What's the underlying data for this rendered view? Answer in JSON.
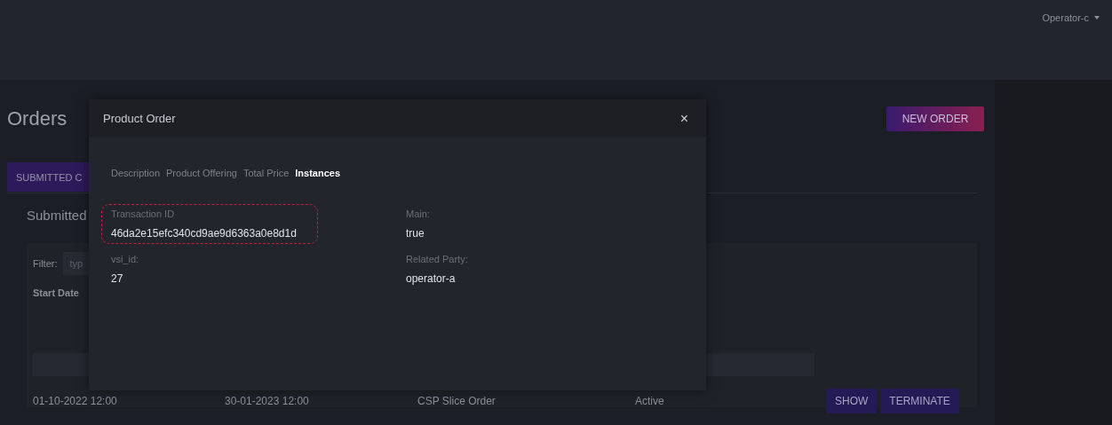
{
  "header": {
    "user": "Operator-c"
  },
  "page": {
    "title": "Orders",
    "new_order_button": "NEW ORDER",
    "tabs": [
      {
        "label": "SUBMITTED C",
        "selected": true
      }
    ],
    "section_title": "Submitted",
    "filter": {
      "label": "Filter:",
      "placeholder": "typ"
    },
    "table": {
      "columns": [
        "Start Date"
      ],
      "rows": [
        {
          "cells": [
            "01-10-2022 12:00",
            "30-01-2023 12:00",
            "CSP Slice Order",
            "Active"
          ],
          "actions": [
            "SHOW",
            "TERMINATE"
          ]
        }
      ]
    }
  },
  "modal": {
    "title": "Product Order",
    "close": "×",
    "tabs": [
      {
        "label": "Description",
        "selected": false
      },
      {
        "label": "Product Offering",
        "selected": false
      },
      {
        "label": "Total Price",
        "selected": false
      },
      {
        "label": "Instances",
        "selected": true
      }
    ],
    "fields": [
      {
        "label": "Transaction ID",
        "value": "46da2e15efc340cd9ae9d6363a0e8d1d",
        "highlighted": true
      },
      {
        "label": "Main:",
        "value": "true",
        "highlighted": false
      },
      {
        "label": "vsi_id:",
        "value": "27",
        "highlighted": false
      },
      {
        "label": "Related Party:",
        "value": "operator-a",
        "highlighted": false
      }
    ]
  }
}
